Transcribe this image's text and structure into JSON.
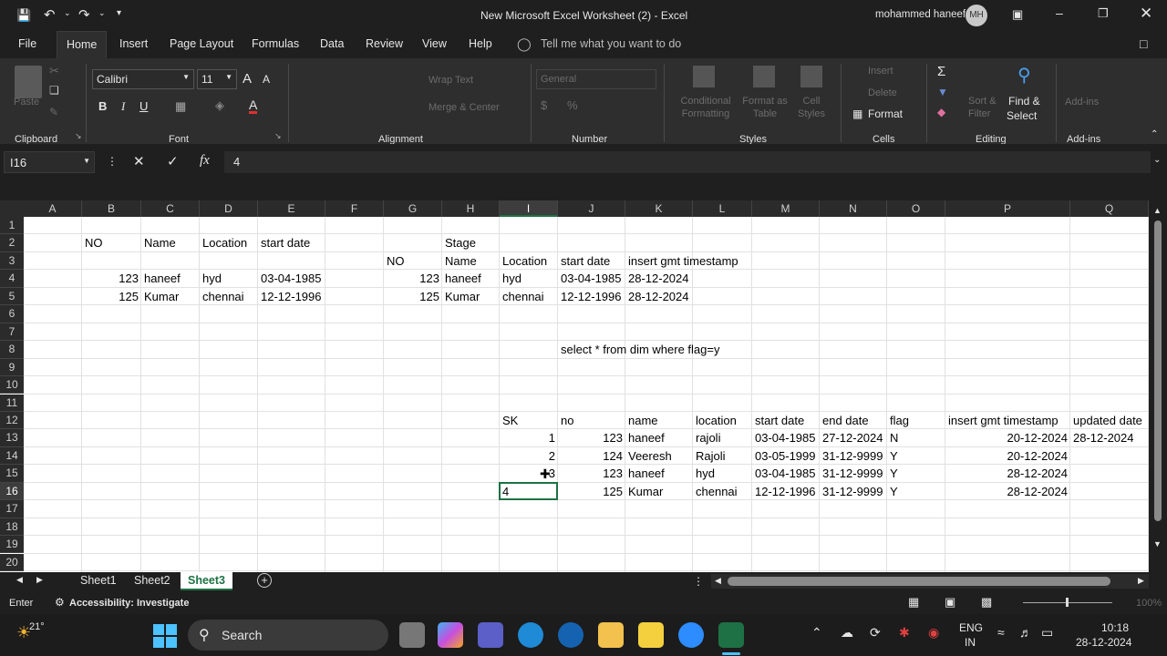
{
  "window": {
    "title": "New Microsoft Excel Worksheet (2)  -  Excel",
    "user": "mohammed haneef",
    "avatar": "MH"
  },
  "menu": [
    "File",
    "Home",
    "Insert",
    "Page Layout",
    "Formulas",
    "Data",
    "Review",
    "View",
    "Help"
  ],
  "tell_me": "Tell me what you want to do",
  "ribbon": {
    "font_name": "Calibri",
    "font_size": "11",
    "groups": {
      "clipboard": "Clipboard",
      "font": "Font",
      "alignment": "Alignment",
      "number": "Number",
      "styles": "Styles",
      "cells": "Cells",
      "editing": "Editing",
      "addins": "Add-ins"
    },
    "paste": "Paste",
    "wrap_text": "Wrap Text",
    "merge_center": "Merge & Center",
    "number_format": "General",
    "conditional": "Conditional Formatting",
    "format_table": "Format as Table",
    "cell_styles": "Cell Styles",
    "insert": "Insert",
    "delete": "Delete",
    "format": "Format",
    "sort_filter": "Sort & Filter",
    "find_select_1": "Find &",
    "find_select_2": "Select",
    "addins": "Add-ins",
    "bold": "B",
    "italic": "I",
    "underline": "U"
  },
  "formula_bar": {
    "name_box": "I16",
    "value": "4",
    "fx": "fx"
  },
  "columns": [
    "A",
    "B",
    "C",
    "D",
    "E",
    "F",
    "G",
    "H",
    "I",
    "J",
    "K",
    "L",
    "M",
    "N",
    "O",
    "P",
    "Q"
  ],
  "rows": [
    "1",
    "2",
    "3",
    "4",
    "5",
    "6",
    "7",
    "8",
    "9",
    "10",
    "11",
    "12",
    "13",
    "14",
    "15",
    "16",
    "17",
    "18",
    "19",
    "20"
  ],
  "cells": {
    "B2": "NO",
    "C2": "Name",
    "D2": "Location",
    "E2": "start date",
    "B4": "123",
    "C4": "haneef",
    "D4": "hyd",
    "E4": "03-04-1985",
    "B5": "125",
    "C5": "Kumar",
    "D5": "chennai",
    "E5": "12-12-1996",
    "H2": "Stage",
    "G3": "NO",
    "H3": "Name",
    "I3": "Location",
    "J3": "start date",
    "K3": "insert gmt timestamp",
    "G4": "123",
    "H4": "haneef",
    "I4": "hyd",
    "J4": "03-04-1985",
    "K4": "28-12-2024",
    "G5": "125",
    "H5": "Kumar",
    "I5": "chennai",
    "J5": "12-12-1996",
    "K5": "28-12-2024",
    "J8": "select * from dim where flag=y",
    "I12": "SK",
    "J12": "no",
    "K12": "name",
    "L12": "location",
    "M12": "start date",
    "N12": "end date",
    "O12": "flag",
    "P12": "insert gmt timestamp",
    "Q12": "updated date",
    "I13": "1",
    "J13": "123",
    "K13": "haneef",
    "L13": "rajoli",
    "M13": "03-04-1985",
    "N13": "27-12-2024",
    "O13": "N",
    "P13": "20-12-2024",
    "Q13": "28-12-2024",
    "I14": "2",
    "J14": "124",
    "K14": "Veeresh",
    "L14": "Rajoli",
    "M14": "03-05-1999",
    "N14": "31-12-9999",
    "O14": "Y",
    "P14": "20-12-2024",
    "I15": "3",
    "J15": "123",
    "K15": "haneef",
    "L15": "hyd",
    "M15": "03-04-1985",
    "N15": "31-12-9999",
    "O15": "Y",
    "P15": "28-12-2024",
    "I16": "4",
    "J16": "125",
    "K16": "Kumar",
    "L16": "chennai",
    "M16": "12-12-1996",
    "N16": "31-12-9999",
    "O16": "Y",
    "P16": "28-12-2024"
  },
  "sheets": [
    "Sheet1",
    "Sheet2",
    "Sheet3"
  ],
  "active_sheet": "Sheet3",
  "status": {
    "mode": "Enter",
    "accessibility": "Accessibility: Investigate",
    "zoom": "100%"
  },
  "taskbar": {
    "weather": "21°",
    "search": "Search",
    "lang1": "ENG",
    "lang2": "IN",
    "time": "10:18",
    "date": "28-12-2024"
  },
  "colors": {
    "accent": "#1e7145",
    "dark": "#1f1f1f",
    "ribbon": "#2e2e2e"
  }
}
